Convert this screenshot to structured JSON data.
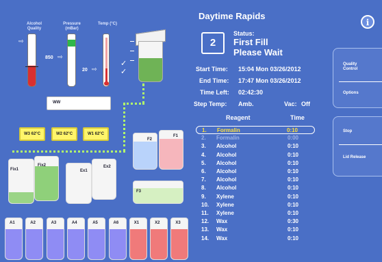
{
  "gauges": {
    "alcohol_label": "Alcohol Quality",
    "pressure_label": "Pressure (mBar)",
    "temp_label": "Temp (°C)",
    "pressure_value": "850",
    "temp_value": "20"
  },
  "tanks": {
    "ww": "WW",
    "w3": "W3  62°C",
    "w2": "W2  62°C",
    "w1": "W1  62°C",
    "fix1": "Fix1",
    "fix2": "Fix2",
    "ex1": "Ex1",
    "ex2": "Ex2",
    "f1": "F1",
    "f2": "F2",
    "f3": "F3",
    "bottom": [
      "A1",
      "A2",
      "A3",
      "A4",
      "A5",
      "A6",
      "X1",
      "X2",
      "X3"
    ]
  },
  "status": {
    "program_name": "Daytime Rapids",
    "step_number": "2",
    "status_label": "Status:",
    "status_line1": "First Fill",
    "status_line2": "Please Wait",
    "start_label": "Start Time:",
    "start_value": "15:04  Mon 03/26/2012",
    "end_label": "End Time:",
    "end_value": "17:47  Mon 03/26/2012",
    "left_label": "Time Left:",
    "left_value": "02:42:30",
    "steptemp_label": "Step Temp:",
    "steptemp_value": "Amb.",
    "vac_label": "Vac:",
    "vac_value": "Off"
  },
  "table": {
    "col_reagent": "Reagent",
    "col_time": "Time",
    "rows": [
      {
        "num": "1.",
        "reagent": "Formalin",
        "time": "0:10"
      },
      {
        "num": "2.",
        "reagent": "Formalin",
        "time": "0:00"
      },
      {
        "num": "3.",
        "reagent": "Alcohol",
        "time": "0:10"
      },
      {
        "num": "4.",
        "reagent": "Alcohol",
        "time": "0:10"
      },
      {
        "num": "5.",
        "reagent": "Alcohol",
        "time": "0:10"
      },
      {
        "num": "6.",
        "reagent": "Alcohol",
        "time": "0:10"
      },
      {
        "num": "7.",
        "reagent": "Alcohol",
        "time": "0:10"
      },
      {
        "num": "8.",
        "reagent": "Alcohol",
        "time": "0:10"
      },
      {
        "num": "9.",
        "reagent": "Xylene",
        "time": "0:10"
      },
      {
        "num": "10.",
        "reagent": "Xylene",
        "time": "0:10"
      },
      {
        "num": "11.",
        "reagent": "Xylene",
        "time": "0:10"
      },
      {
        "num": "12.",
        "reagent": "Wax",
        "time": "0:30"
      },
      {
        "num": "13.",
        "reagent": "Wax",
        "time": "0:10"
      },
      {
        "num": "14.",
        "reagent": "Wax",
        "time": "0:10"
      }
    ]
  },
  "buttons": {
    "info": "i",
    "quality_control": "Quality Control",
    "options": "Options",
    "stop": "Stop",
    "lid_release": "Lid Release"
  },
  "colors": {
    "background": "#4a6fc6",
    "highlight_text": "#ffdf3a",
    "alcohol_red": "#d93030",
    "pressure_green": "#2fb84a",
    "blue_bottle": "#8f8cf4",
    "red_bottle": "#f07a7a",
    "green_fill": "#8fd07a"
  }
}
